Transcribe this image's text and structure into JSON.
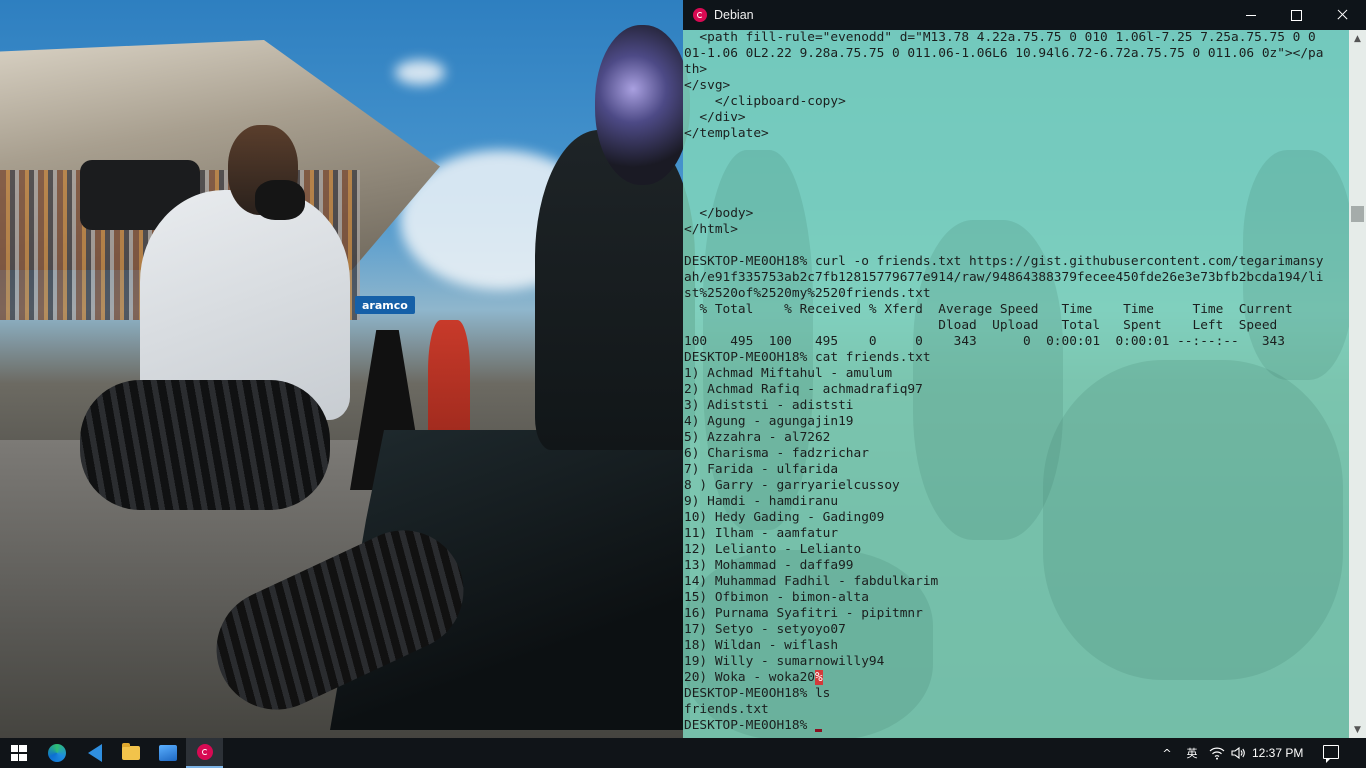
{
  "window": {
    "title": "Debian",
    "controls": {
      "minimize": "minimize",
      "maximize": "maximize",
      "close": "close"
    }
  },
  "wallpaper": {
    "banner_text": "aramco"
  },
  "terminal": {
    "lines": [
      "  <path fill-rule=\"evenodd\" d=\"M13.78 4.22a.75.75 0 010 1.06l-7.25 7.25a.75.75 0 0",
      "01-1.06 0L2.22 9.28a.75.75 0 011.06-1.06L6 10.94l6.72-6.72a.75.75 0 011.06 0z\"></pa",
      "th>",
      "</svg>",
      "    </clipboard-copy>",
      "  </div>",
      "</template>",
      "",
      "",
      "",
      "",
      "  </body>",
      "</html>",
      "",
      "DESKTOP-ME0OH18% curl -o friends.txt https://gist.githubusercontent.com/tegarimansy",
      "ah/e91f335753ab2c7fb12815779677e914/raw/94864388379fecee450fde26e3e73bfb2bcda194/li",
      "st%2520of%2520my%2520friends.txt",
      "  % Total    % Received % Xferd  Average Speed   Time    Time     Time  Current",
      "                                 Dload  Upload   Total   Spent    Left  Speed",
      "100   495  100   495    0     0    343      0  0:00:01  0:00:01 --:--:--   343",
      "DESKTOP-ME0OH18% cat friends.txt",
      "1) Achmad Miftahul - amulum",
      "2) Achmad Rafiq - achmadrafiq97",
      "3) Adiststi - adiststi",
      "4) Agung - agungajin19",
      "5) Azzahra - al7262",
      "6) Charisma - fadzrichar",
      "7) Farida - ulfarida",
      "8 ) Garry - garryarielcussoy",
      "9) Hamdi - hamdiranu",
      "10) Hedy Gading - Gading09",
      "11) Ilham - aamfatur",
      "12) Lelianto - Lelianto",
      "13) Mohammad - daffa99",
      "14) Muhammad Fadhil - fabdulkarim",
      "15) Ofbimon - bimon-alta",
      "16) Purnama Syafitri - pipitmnr",
      "17) Setyo - setyoyo07",
      "18) Wildan - wiflash",
      "19) Willy - sumarnowilly94",
      "20) Woka - woka20",
      "DESKTOP-ME0OH18% ls",
      "friends.txt",
      "DESKTOP-ME0OH18% "
    ],
    "eof_marker": "%",
    "eof_marker_line_index": 40
  },
  "taskbar": {
    "apps": [
      "start-menu",
      "edge-browser",
      "vscode",
      "file-explorer",
      "photos",
      "debian-terminal"
    ],
    "tray": {
      "chevron": "^",
      "ime": "英",
      "wifi": "wifi",
      "volume": "volume",
      "clock": "12:37 PM"
    }
  },
  "colors": {
    "terminal_bg": "#7ed4bc",
    "titlebar_bg": "#0e1419",
    "debian_red": "#d70a53",
    "taskbar_bg": "#101418"
  }
}
